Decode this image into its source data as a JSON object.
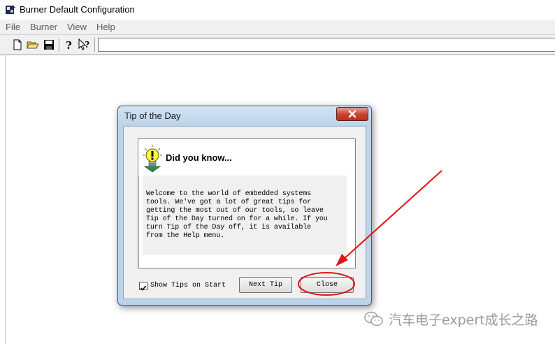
{
  "window": {
    "title": "Burner  Default Configuration"
  },
  "menu": [
    "File",
    "Burner",
    "View",
    "Help"
  ],
  "toolbar": {
    "buttons": [
      "new-file-icon",
      "open-folder-icon",
      "save-icon",
      "help-icon",
      "context-help-icon"
    ]
  },
  "dialog": {
    "title": "Tip of the Day",
    "heading": "Did you know...",
    "tip_lines": [
      "Welcome to the world of embedded systems",
      "tools. We've got a lot of great tips for",
      "getting the most out of our tools, so leave",
      "Tip of the Day turned on for a while. If you",
      "turn Tip of the Day off, it is available",
      "from the Help menu."
    ],
    "show_tips_label": "Show Tips on Start",
    "show_tips_checked": true,
    "next_tip_label": "Next Tip",
    "close_label": "Close"
  },
  "annotation": {
    "color": "#e31212"
  },
  "watermark": {
    "text": "汽车电子expert成长之路"
  }
}
